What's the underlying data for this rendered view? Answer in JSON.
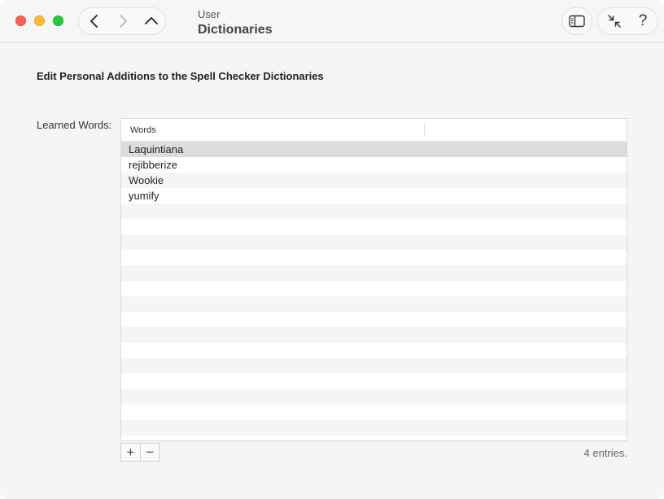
{
  "window": {
    "title_small": "User",
    "title_big": "Dictionaries",
    "help_label": "?"
  },
  "icons": {
    "back": "chevron-left-icon",
    "forward": "chevron-right-icon",
    "up": "chevron-up-icon",
    "sidebar": "sidebar-icon",
    "collapse": "collapse-arrows-icon"
  },
  "main": {
    "heading": "Edit Personal Additions to the Spell Checker Dictionaries",
    "learned_label": "Learned Words:",
    "table": {
      "column_header": "Words",
      "rows": [
        "Laquintiana",
        "rejibberize",
        "Wookie",
        "yumify"
      ],
      "selected_index": 0
    },
    "add_label": "+",
    "remove_label": "−",
    "entries_text": "4 entries."
  },
  "colors": {
    "close": "#ff5f57",
    "minimize": "#febc2e",
    "zoom": "#28c840",
    "selected_row": "#dcdcdc"
  }
}
